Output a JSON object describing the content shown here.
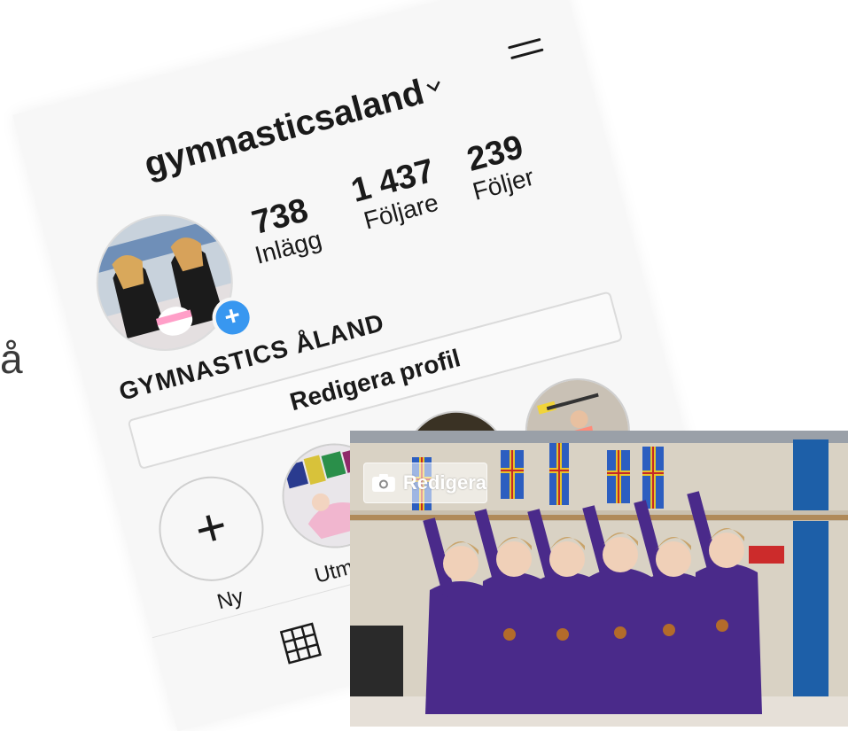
{
  "stray_glyph": "å",
  "profile": {
    "username": "gymnasticsaland",
    "full_name": "GYMNASTICS ÅLAND",
    "edit_profile_label": "Redigera profil"
  },
  "stats": [
    {
      "value": "738",
      "label": "Inlägg"
    },
    {
      "value": "1 437",
      "label": "Följare"
    },
    {
      "value": "239",
      "label": "Följer"
    }
  ],
  "highlights": [
    {
      "label": "Ny"
    },
    {
      "label": "Utmanin"
    },
    {
      "label": ""
    },
    {
      "label": ""
    }
  ],
  "photo_overlay": {
    "edit_label": "Redigera",
    "icon": "camera-icon"
  },
  "colors": {
    "accent": "#3897f0",
    "leotard": "#4a2a8a"
  }
}
